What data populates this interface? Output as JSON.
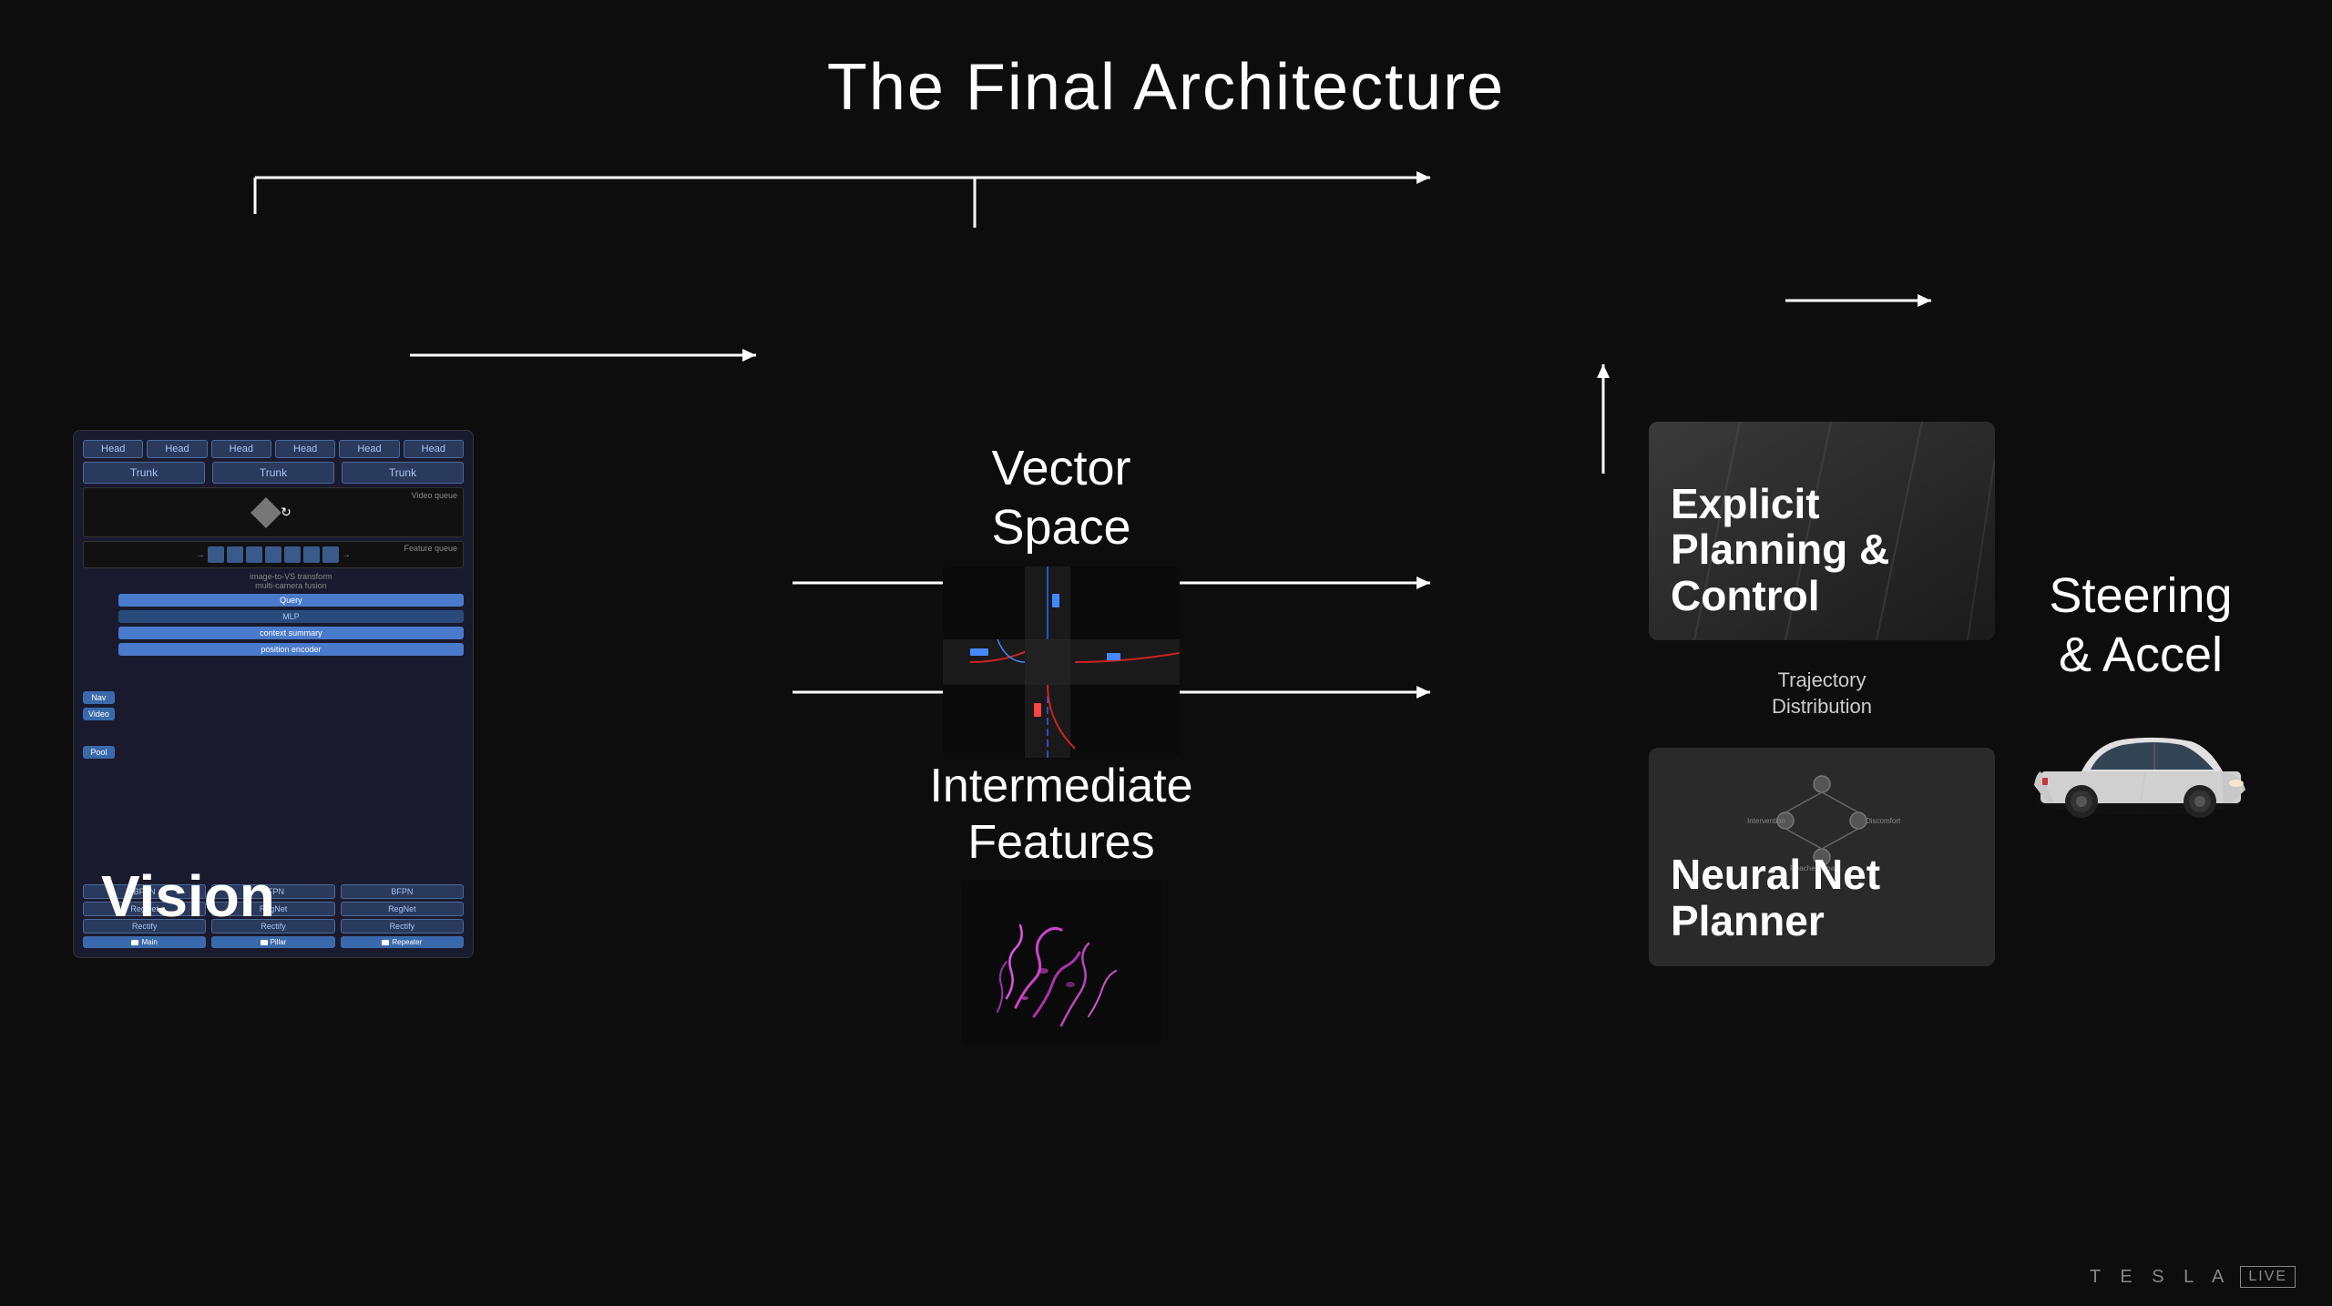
{
  "title": "The Final Architecture",
  "vision": {
    "label": "Vision",
    "heads": [
      "Head",
      "Head",
      "Head",
      "Head",
      "Head",
      "Head"
    ],
    "trunks": [
      "Trunk",
      "Trunk",
      "Trunk"
    ],
    "videoQueue": "Video queue",
    "featureQueue": "Feature queue",
    "leftLabels": [
      "Nav",
      "Video"
    ],
    "innerLabels": [
      "Query",
      "MLP",
      "context summary",
      "position encoder"
    ],
    "poolLabel": "Pool",
    "cameras": [
      {
        "bfpn": "BFPN",
        "regnet": "RegNet",
        "rectify": "Rectify",
        "name": "Main"
      },
      {
        "bfpn": "BFPN",
        "regnet": "RegNet",
        "rectify": "Rectify",
        "name": "Pillar"
      },
      {
        "bfpn": "BFPN",
        "regnet": "RegNet",
        "rectify": "Rectify",
        "name": "Repeater"
      }
    ]
  },
  "vectorSpace": {
    "label": "Vector\nSpace"
  },
  "intermediateFeatures": {
    "label": "Intermediate\nFeatures"
  },
  "explicitPlanning": {
    "label": "Explicit\nPlanning &\nControl"
  },
  "neuralNetPlanner": {
    "label": "Neural Net\nPlanner",
    "nodeLabels": [
      "Intervention",
      "Discomfort",
      "Reaches Goal"
    ],
    "trajectoryLabel": "Trajectory\nDistribution"
  },
  "steeringAccel": {
    "label": "Steering\n& Accel"
  },
  "footer": {
    "teslaText": "T E S L A",
    "liveBadge": "LIVE"
  }
}
